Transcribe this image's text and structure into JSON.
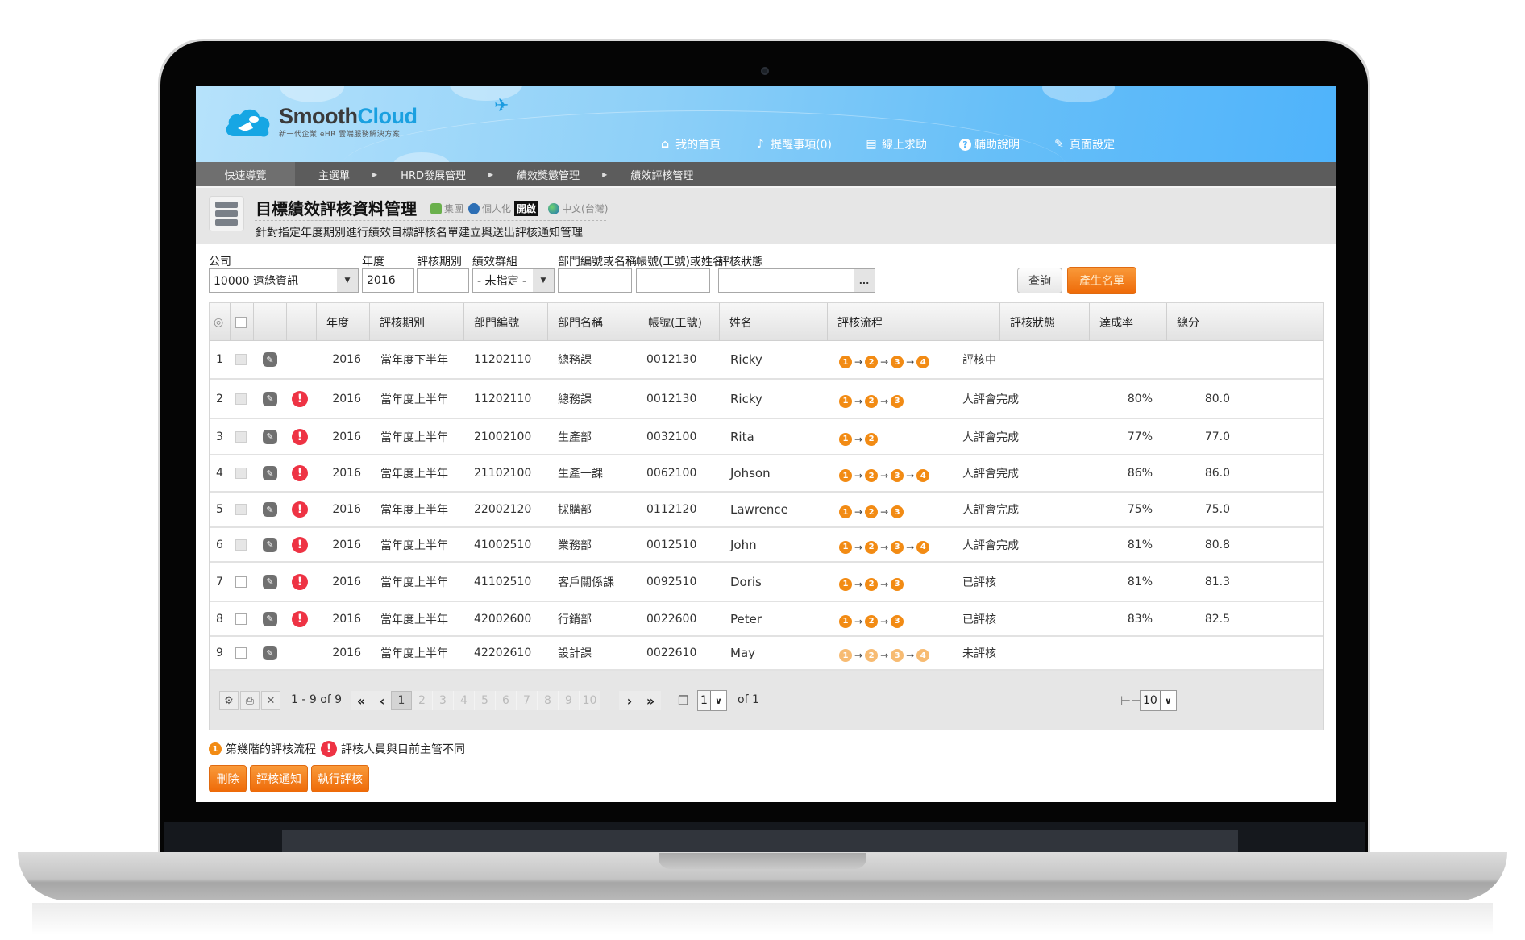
{
  "brand": {
    "name_part1": "Smooth",
    "name_part2": "Cloud",
    "tagline": "新一代企業 eHR 雲端服務解決方案"
  },
  "top_links": [
    {
      "icon": "home-icon",
      "glyph": "⌂",
      "label": "我的首頁"
    },
    {
      "icon": "bell-icon",
      "glyph": "♪",
      "label": "提醒事項(0)"
    },
    {
      "icon": "help-doc-icon",
      "glyph": "▤",
      "label": "線上求助"
    },
    {
      "icon": "question-icon",
      "glyph": "?",
      "label": "輔助說明"
    },
    {
      "icon": "settings-brush-icon",
      "glyph": "✎",
      "label": "頁面設定"
    }
  ],
  "nav": {
    "quick": "快速導覽",
    "crumbs": [
      "主選單",
      "HRD發展管理",
      "績效獎懲管理",
      "績效評核管理"
    ],
    "separator": "▶"
  },
  "page": {
    "title": "目標績效評核資料管理",
    "group_label": "集團",
    "personal_label": "個人化",
    "open_badge": "開啟",
    "language": "中文(台灣)",
    "description": "針對指定年度期別進行績效目標評核名單建立與送出評核通知管理"
  },
  "filters": {
    "company_label": "公司",
    "company_value": "10000 遠綠資訊",
    "year_label": "年度",
    "year_value": "2016",
    "period_label": "評核期別",
    "period_value": "",
    "group_label": "績效群組",
    "group_value": "- 未指定 -",
    "dept_label": "部門編號或名稱",
    "dept_value": "",
    "account_label": "帳號(工號)或姓名",
    "account_value": "",
    "status_label": "評核狀態",
    "status_value": "",
    "ellipsis": "...",
    "query_button": "查詢",
    "generate_button": "產生名單"
  },
  "grid": {
    "columns": [
      "年度",
      "評核期別",
      "部門編號",
      "部門名稱",
      "帳號(工號)",
      "姓名",
      "評核流程",
      "評核狀態",
      "達成率",
      "總分"
    ],
    "rows": [
      {
        "no": "1",
        "checkbox": "disabled",
        "warning": false,
        "year": "2016",
        "period": "當年度下半年",
        "dept_no": "11202110",
        "dept_name": "總務課",
        "account": "0012130",
        "name": "Ricky",
        "flow_steps": 4,
        "flow_faded": false,
        "status": "評核中",
        "rate": "",
        "score": ""
      },
      {
        "no": "2",
        "checkbox": "disabled",
        "warning": true,
        "year": "2016",
        "period": "當年度上半年",
        "dept_no": "11202110",
        "dept_name": "總務課",
        "account": "0012130",
        "name": "Ricky",
        "flow_steps": 3,
        "flow_faded": false,
        "status": "人評會完成",
        "rate": "80%",
        "score": "80.0"
      },
      {
        "no": "3",
        "checkbox": "disabled",
        "warning": true,
        "year": "2016",
        "period": "當年度上半年",
        "dept_no": "21002100",
        "dept_name": "生產部",
        "account": "0032100",
        "name": "Rita",
        "flow_steps": 2,
        "flow_faded": false,
        "status": "人評會完成",
        "rate": "77%",
        "score": "77.0"
      },
      {
        "no": "4",
        "checkbox": "disabled",
        "warning": true,
        "year": "2016",
        "period": "當年度上半年",
        "dept_no": "21102100",
        "dept_name": "生產一課",
        "account": "0062100",
        "name": "Johson",
        "flow_steps": 4,
        "flow_faded": false,
        "status": "人評會完成",
        "rate": "86%",
        "score": "86.0"
      },
      {
        "no": "5",
        "checkbox": "disabled",
        "warning": true,
        "year": "2016",
        "period": "當年度上半年",
        "dept_no": "22002120",
        "dept_name": "採購部",
        "account": "0112120",
        "name": "Lawrence",
        "flow_steps": 3,
        "flow_faded": false,
        "status": "人評會完成",
        "rate": "75%",
        "score": "75.0"
      },
      {
        "no": "6",
        "checkbox": "disabled",
        "warning": true,
        "year": "2016",
        "period": "當年度上半年",
        "dept_no": "41002510",
        "dept_name": "業務部",
        "account": "0012510",
        "name": "John",
        "flow_steps": 4,
        "flow_faded": false,
        "status": "人評會完成",
        "rate": "81%",
        "score": "80.8"
      },
      {
        "no": "7",
        "checkbox": "enabled",
        "warning": true,
        "year": "2016",
        "period": "當年度上半年",
        "dept_no": "41102510",
        "dept_name": "客戶關係課",
        "account": "0092510",
        "name": "Doris",
        "flow_steps": 3,
        "flow_faded": false,
        "status": "已評核",
        "rate": "81%",
        "score": "81.3"
      },
      {
        "no": "8",
        "checkbox": "enabled",
        "warning": true,
        "year": "2016",
        "period": "當年度上半年",
        "dept_no": "42002600",
        "dept_name": "行銷部",
        "account": "0022600",
        "name": "Peter",
        "flow_steps": 3,
        "flow_faded": false,
        "status": "已評核",
        "rate": "83%",
        "score": "82.5"
      },
      {
        "no": "9",
        "checkbox": "enabled",
        "warning": false,
        "year": "2016",
        "period": "當年度上半年",
        "dept_no": "42202610",
        "dept_name": "設計課",
        "account": "0022610",
        "name": "May",
        "flow_steps": 4,
        "flow_faded": true,
        "status": "未評核",
        "rate": "",
        "score": ""
      }
    ]
  },
  "pager": {
    "range_text": "1 - 9 of 9",
    "pages": [
      "1",
      "2",
      "3",
      "4",
      "5",
      "6",
      "7",
      "8",
      "9",
      "10"
    ],
    "current_page": "1",
    "page_select": "1",
    "of_text": "of 1",
    "page_size": "10"
  },
  "legend": {
    "step_label": "第幾階的評核流程",
    "warning_label": "評核人員與目前主管不同"
  },
  "actions": {
    "delete": "刪除",
    "notify": "評核通知",
    "execute": "執行評核"
  },
  "colors": {
    "accent_orange": "#f28b14",
    "warning_red": "#ee3344",
    "header_blue": "#4fb3fb",
    "brand_blue": "#1aa0e0",
    "nav_gray": "#5c5c5c"
  }
}
